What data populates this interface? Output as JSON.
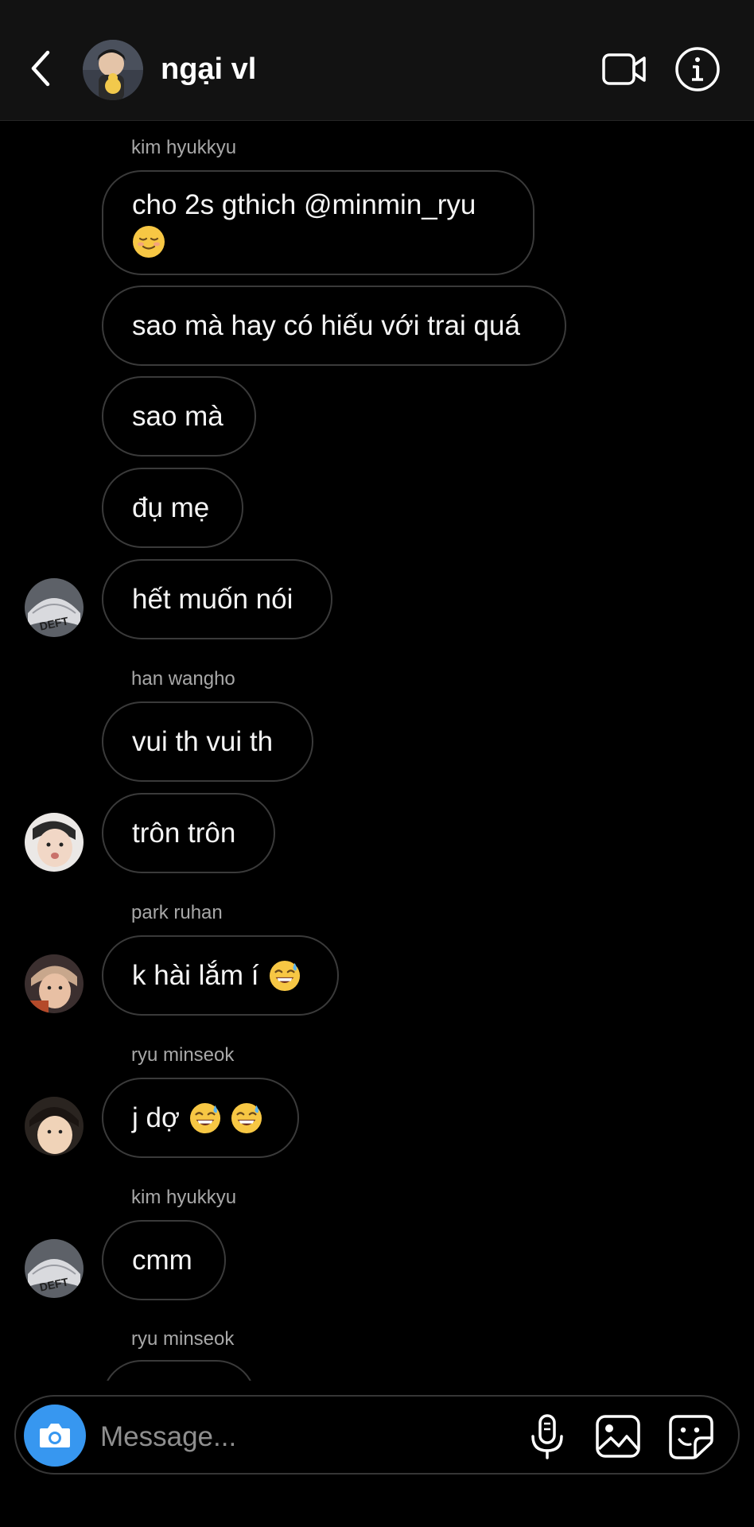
{
  "header": {
    "title": "ngại vl",
    "icons": {
      "back": "chevron-left-icon",
      "video": "video-camera-icon",
      "info": "info-icon"
    }
  },
  "messages": [
    {
      "sender": "kim hyukkyu",
      "bubbles": [
        "cho 2s gthich @minmin_ryu",
        "sao mà hay có hiếu với trai quá",
        "sao mà",
        "đụ mẹ",
        "hết muốn nói"
      ],
      "emoji_first": "relieved-face-emoji",
      "avatar": "avatar-deft"
    },
    {
      "sender": "han wangho",
      "bubbles": [
        "vui th vui th",
        "trôn trôn"
      ],
      "avatar": "avatar-han-wangho"
    },
    {
      "sender": "park ruhan",
      "bubbles": [
        "k hài lắm í"
      ],
      "emoji": "grinning-sweat-emoji",
      "avatar": "avatar-park-ruhan"
    },
    {
      "sender": "ryu minseok",
      "bubbles": [
        "j dợ"
      ],
      "emoji": "grinning-sweat-emoji",
      "avatar": "avatar-ryu-minseok"
    },
    {
      "sender": "kim hyukkyu",
      "bubbles": [
        "cmm"
      ],
      "avatar": "avatar-deft"
    },
    {
      "sender": "ryu minseok",
      "bubbles": []
    }
  ],
  "deft_cap_text": "DEFT",
  "composer": {
    "placeholder": "Message...",
    "icons": {
      "camera": "camera-icon",
      "mic": "microphone-icon",
      "gallery": "image-icon",
      "sticker": "sticker-icon"
    }
  },
  "colors": {
    "background": "#000000",
    "header": "#121212",
    "bubble_border": "#3a3a3a",
    "sender_text": "#a8a8a8",
    "camera_button": "#3797f0"
  }
}
